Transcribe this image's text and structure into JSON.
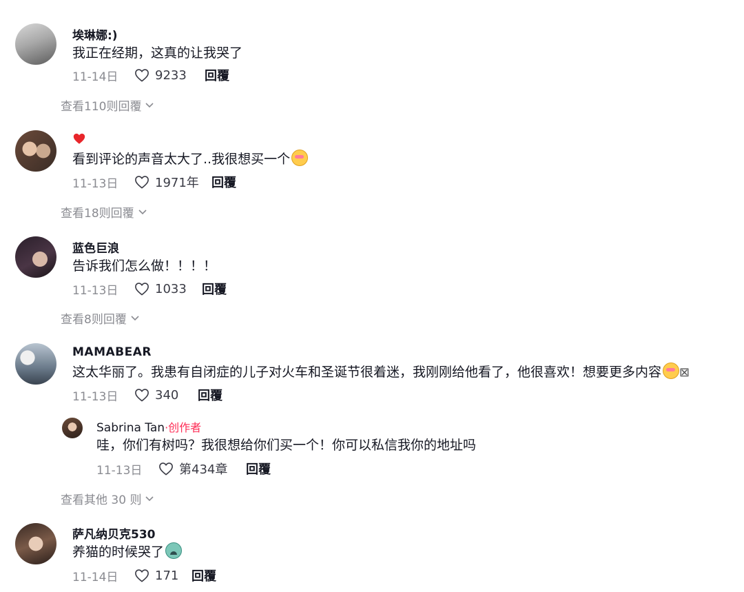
{
  "comments": [
    {
      "username": "埃琳娜:)",
      "text": "我正在经期，这真的让我哭了",
      "date": "11-14日",
      "likes": "9233",
      "reply_label": "回覆",
      "view_replies": "查看110则回覆"
    },
    {
      "username": "",
      "badge": "heart-icon",
      "text": "看到评论的声音太大了..我很想买一个",
      "emoji": "smiling-face-with-hearts",
      "date": "11-13日",
      "likes": "1971年",
      "reply_label": "回覆",
      "view_replies": "查看18则回覆"
    },
    {
      "username": "蓝色巨浪",
      "text": "告诉我们怎么做！！！！",
      "date": "11-13日",
      "likes": "1033",
      "reply_label": "回覆",
      "view_replies": "查看8则回覆"
    },
    {
      "username": "MAMABEAR",
      "text": "这太华丽了。我患有自闭症的儿子对火车和圣诞节很着迷，我刚刚给他看了，他很喜欢！想要更多内容",
      "emoji": "smiling-face-with-hearts",
      "trailing": "⊠",
      "date": "11-13日",
      "likes": "340",
      "reply_label": "回覆"
    },
    {
      "username": "萨凡纳贝克530",
      "text": "养猫的时候哭了",
      "emoji": "crying-face",
      "date": "11-14日",
      "likes": "171",
      "reply_label": "回覆"
    }
  ],
  "reply": {
    "username": "Sabrina Tan",
    "creator_label": "·创作者",
    "text": "哇，你们有树吗？我很想给你们买一个！你可以私信我你的地址吗",
    "date": "11-13日",
    "likes": "第434章",
    "reply_label": "回覆",
    "view_more": "查看其他 30 则"
  },
  "colors": {
    "accent": "#fe2c55",
    "muted": "#8a8b91",
    "text": "#161823"
  }
}
